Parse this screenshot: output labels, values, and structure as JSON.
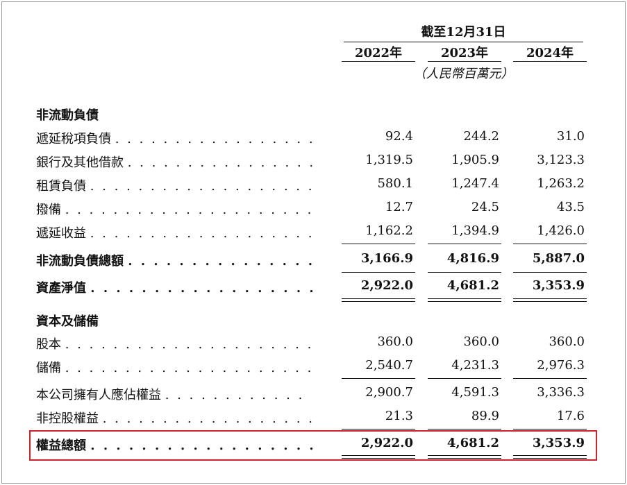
{
  "header": {
    "period": "截至12月31日",
    "years": [
      "2022年",
      "2023年",
      "2024年"
    ],
    "unit": "（人民幣百萬元）"
  },
  "rows": [
    {
      "label": "非流動負債",
      "type": "section"
    },
    {
      "label": "遞延稅項負債",
      "dots": ". . . . . . . . . . . . . . . . . . . . . .",
      "values": [
        "92.4",
        "244.2",
        "31.0"
      ]
    },
    {
      "label": "銀行及其他借款",
      "dots": ". . . . . . . . . . . . . . . . . . .",
      "values": [
        "1,319.5",
        "1,905.9",
        "3,123.3"
      ]
    },
    {
      "label": "租賃負債",
      "dots": ". . . . . . . . . . . . . . . . . . . . . . . . .",
      "values": [
        "580.1",
        "1,247.4",
        "1,263.2"
      ]
    },
    {
      "label": "撥備",
      "dots": ". . . . . . . . . . . . . . . . . . . . . . . . . . . . .",
      "values": [
        "12.7",
        "24.5",
        "43.5"
      ]
    },
    {
      "label": "遞延收益",
      "dots": ". . . . . . . . . . . . . . . . . . . . . . . . .",
      "values": [
        "1,162.2",
        "1,394.9",
        "1,426.0"
      ]
    },
    {
      "label": "非流動負債總額",
      "dots": ". . . . . . . . . . . . . . . . . . .",
      "values": [
        "3,166.9",
        "4,816.9",
        "5,887.0"
      ],
      "type": "total"
    },
    {
      "label": "資產淨值",
      "dots": ". . . . . . . . . . . . . . . . . . . . . . . . .",
      "values": [
        "2,922.0",
        "4,681.2",
        "3,353.9"
      ],
      "type": "total"
    },
    {
      "label": "資本及儲備",
      "type": "section"
    },
    {
      "label": "股本",
      "dots": ". . . . . . . . . . . . . . . . . . . . . . . . . . . . .",
      "values": [
        "360.0",
        "360.0",
        "360.0"
      ]
    },
    {
      "label": "儲備",
      "dots": ". . . . . . . . . . . . . . . . . . . . . . . . . . . . .",
      "values": [
        "2,540.7",
        "4,231.3",
        "2,976.3"
      ]
    },
    {
      "label": "本公司擁有人應佔權益",
      "dots": ". . . . . . . . . . . .",
      "values": [
        "2,900.7",
        "4,591.3",
        "3,336.3"
      ]
    },
    {
      "label": "非控股權益",
      "dots": ". . . . . . . . . . . . . . . . . . . . . . .",
      "values": [
        "21.3",
        "89.9",
        "17.6"
      ]
    },
    {
      "label": "權益總額",
      "dots": ". . . . . . . . . . . . . . . . . . . . . . . . .",
      "values": [
        "2,922.0",
        "4,681.2",
        "3,353.9"
      ],
      "type": "total"
    }
  ],
  "highlight_color": "#d0202a"
}
